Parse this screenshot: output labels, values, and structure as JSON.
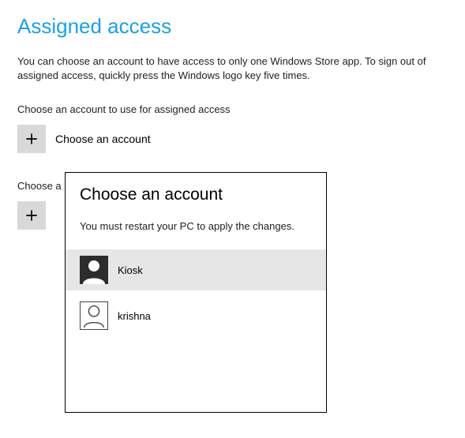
{
  "page": {
    "title": "Assigned access",
    "description": "You can choose an account to have access to only one Windows Store app. To sign out of assigned access, quickly press the Windows logo key five times."
  },
  "sections": {
    "account_label": "Choose an account to use for assigned access",
    "choose_account": "Choose an account",
    "app_label_truncated": "Choose a",
    "choose_app": ""
  },
  "popup": {
    "title": "Choose an account",
    "subtext": "You must restart your PC to apply the changes.",
    "accounts": [
      {
        "name": "Kiosk",
        "selected": true,
        "avatar_filled": true
      },
      {
        "name": "krishna",
        "selected": false,
        "avatar_filled": false
      }
    ]
  }
}
